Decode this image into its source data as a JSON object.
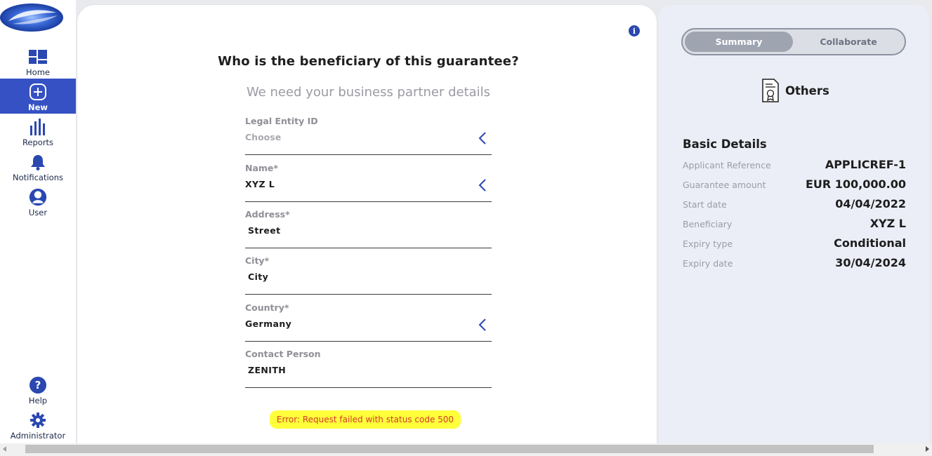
{
  "colors": {
    "accent": "#3551c4",
    "icon_blue": "#2a48b0",
    "error_bg": "#ffff3a",
    "error_text": "#d23a2a",
    "panel_bg": "#eceef7"
  },
  "sidebar": {
    "logo_icon": "globe-logo",
    "items": [
      {
        "label": "Home",
        "icon": "dashboard-icon",
        "active": false
      },
      {
        "label": "New",
        "icon": "plus-circle-icon",
        "active": true
      },
      {
        "label": "Reports",
        "icon": "bar-chart-icon",
        "active": false
      },
      {
        "label": "Notifications",
        "icon": "bell-icon",
        "active": false
      },
      {
        "label": "User",
        "icon": "user-icon",
        "active": false
      }
    ],
    "bottom_items": [
      {
        "label": "Help",
        "icon": "question-icon"
      },
      {
        "label": "Administrator",
        "icon": "gear-icon"
      }
    ]
  },
  "form": {
    "question": "Who is the beneficiary of this guarantee?",
    "subtitle": "We need your business partner details",
    "fields": [
      {
        "label": "Legal Entity ID",
        "value": "",
        "placeholder": "Choose",
        "has_dropdown": true
      },
      {
        "label": "Name*",
        "value": "XYZ L",
        "has_dropdown": true
      },
      {
        "label": "Address*",
        "value": "Street",
        "has_dropdown": false
      },
      {
        "label": "City*",
        "value": "City",
        "has_dropdown": false
      },
      {
        "label": "Country*",
        "value": "Germany",
        "has_dropdown": true
      },
      {
        "label": "Contact Person",
        "value": "ZENITH",
        "has_dropdown": false
      }
    ],
    "error": "Error: Request failed with status code 500"
  },
  "summary_panel": {
    "tabs": [
      {
        "label": "Summary",
        "active": true
      },
      {
        "label": "Collaborate",
        "active": false
      }
    ],
    "type_icon": "certificate-document-icon",
    "type_title": "Others",
    "section_title": "Basic Details",
    "details": [
      {
        "key": "Applicant Reference",
        "value": "APPLICREF-1"
      },
      {
        "key": "Guarantee amount",
        "value": "EUR 100,000.00"
      },
      {
        "key": "Start date",
        "value": "04/04/2022"
      },
      {
        "key": "Beneficiary",
        "value": "XYZ L"
      },
      {
        "key": "Expiry type",
        "value": "Conditional"
      },
      {
        "key": "Expiry date",
        "value": "30/04/2024"
      }
    ]
  }
}
